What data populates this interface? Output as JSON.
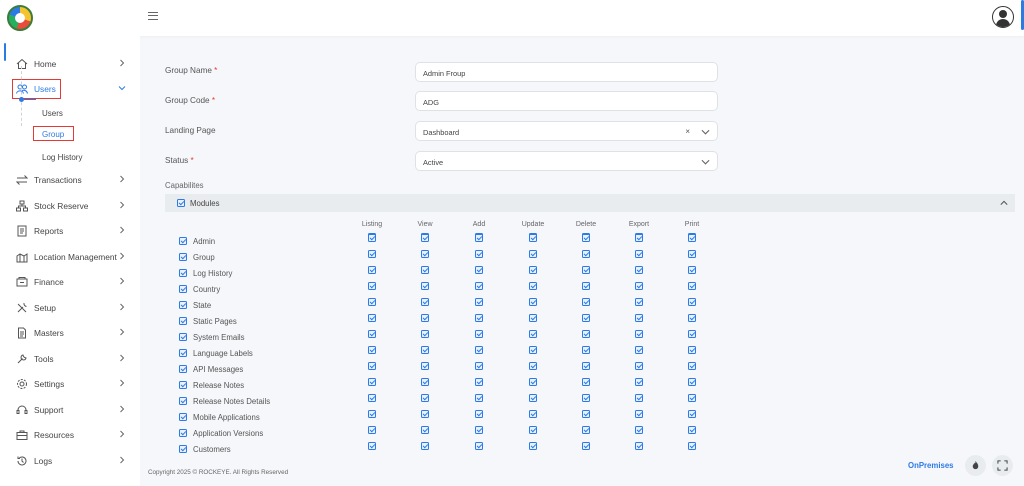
{
  "sidebar": {
    "items": [
      {
        "label": "Home",
        "icon": "home-icon"
      },
      {
        "label": "Users",
        "icon": "users-icon"
      },
      {
        "label": "Transactions",
        "icon": "arrows-icon"
      },
      {
        "label": "Stock Reserve",
        "icon": "hierarchy-icon"
      },
      {
        "label": "Reports",
        "icon": "report-icon"
      },
      {
        "label": "Location Management",
        "icon": "location-icon"
      },
      {
        "label": "Finance",
        "icon": "finance-icon"
      },
      {
        "label": "Setup",
        "icon": "tools-icon"
      },
      {
        "label": "Masters",
        "icon": "document-icon"
      },
      {
        "label": "Tools",
        "icon": "wrench-icon"
      },
      {
        "label": "Settings",
        "icon": "gear-icon"
      },
      {
        "label": "Support",
        "icon": "headset-icon"
      },
      {
        "label": "Resources",
        "icon": "briefcase-icon"
      },
      {
        "label": "Logs",
        "icon": "history-icon"
      }
    ],
    "users_sub": [
      "Users",
      "Group",
      "Log History"
    ]
  },
  "form": {
    "group_name_label": "Group Name",
    "group_name_value": "Admin Froup",
    "group_code_label": "Group Code",
    "group_code_value": "ADG",
    "landing_page_label": "Landing Page",
    "landing_page_value": "Dashboard",
    "status_label": "Status",
    "status_value": "Active",
    "required_mark": "*",
    "clear_mark": "×"
  },
  "capabilities": {
    "label": "Capabilites",
    "modules_label": "Modules",
    "columns": [
      "Listing",
      "View",
      "Add",
      "Update",
      "Delete",
      "Export",
      "Print"
    ],
    "rows": [
      "Admin",
      "Group",
      "Log History",
      "Country",
      "State",
      "Static Pages",
      "System Emails",
      "Language Labels",
      "API Messages",
      "Release Notes",
      "Release Notes Details",
      "Mobile Applications",
      "Application Versions",
      "Customers"
    ]
  },
  "footer": {
    "copyright": "Copyright 2025 © ROCKEYE. All Rights Reserved",
    "mode": "OnPremises"
  },
  "colors": {
    "accent": "#2c7be5",
    "highlight": "#e53935"
  }
}
